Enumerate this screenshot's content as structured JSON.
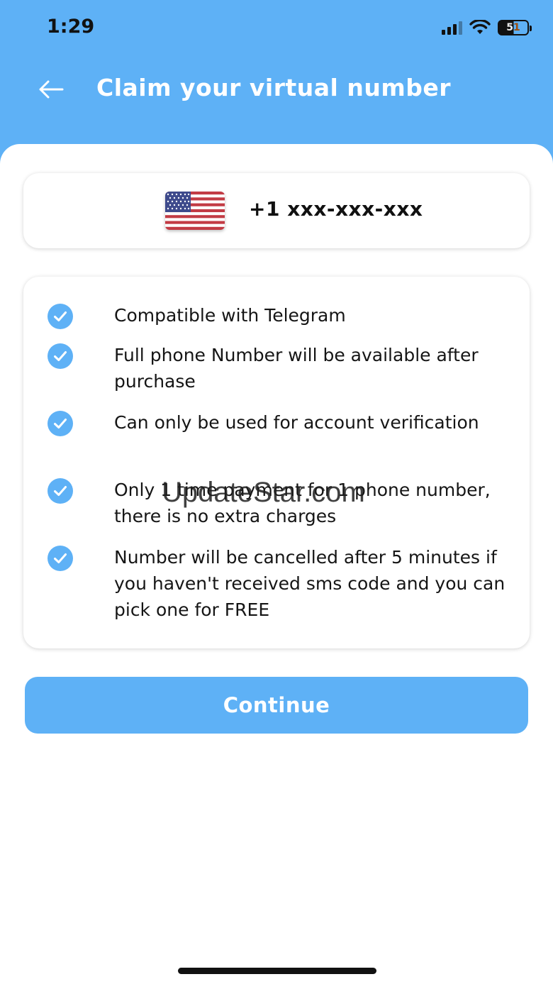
{
  "status_bar": {
    "time": "1:29",
    "battery_level": "51"
  },
  "header": {
    "title": "Claim your virtual number",
    "background_color": "#5eb1f6"
  },
  "number_card": {
    "flag_icon": "us-flag-icon",
    "phone_number": "+1 xxx-xxx-xxx"
  },
  "features": [
    "Compatible with Telegram",
    "Full phone Number will be available after purchase",
    "Can only be used for account verification",
    "Only 1 time payment for 1 phone number, there is no extra charges",
    "Number will be cancelled after 5 minutes if you haven't received sms code and you can pick one for FREE"
  ],
  "continue_button": {
    "label": "Continue"
  },
  "watermark": "UpdateStar.com",
  "colors": {
    "accent": "#5eb1f6",
    "check": "#5eb1f6"
  }
}
